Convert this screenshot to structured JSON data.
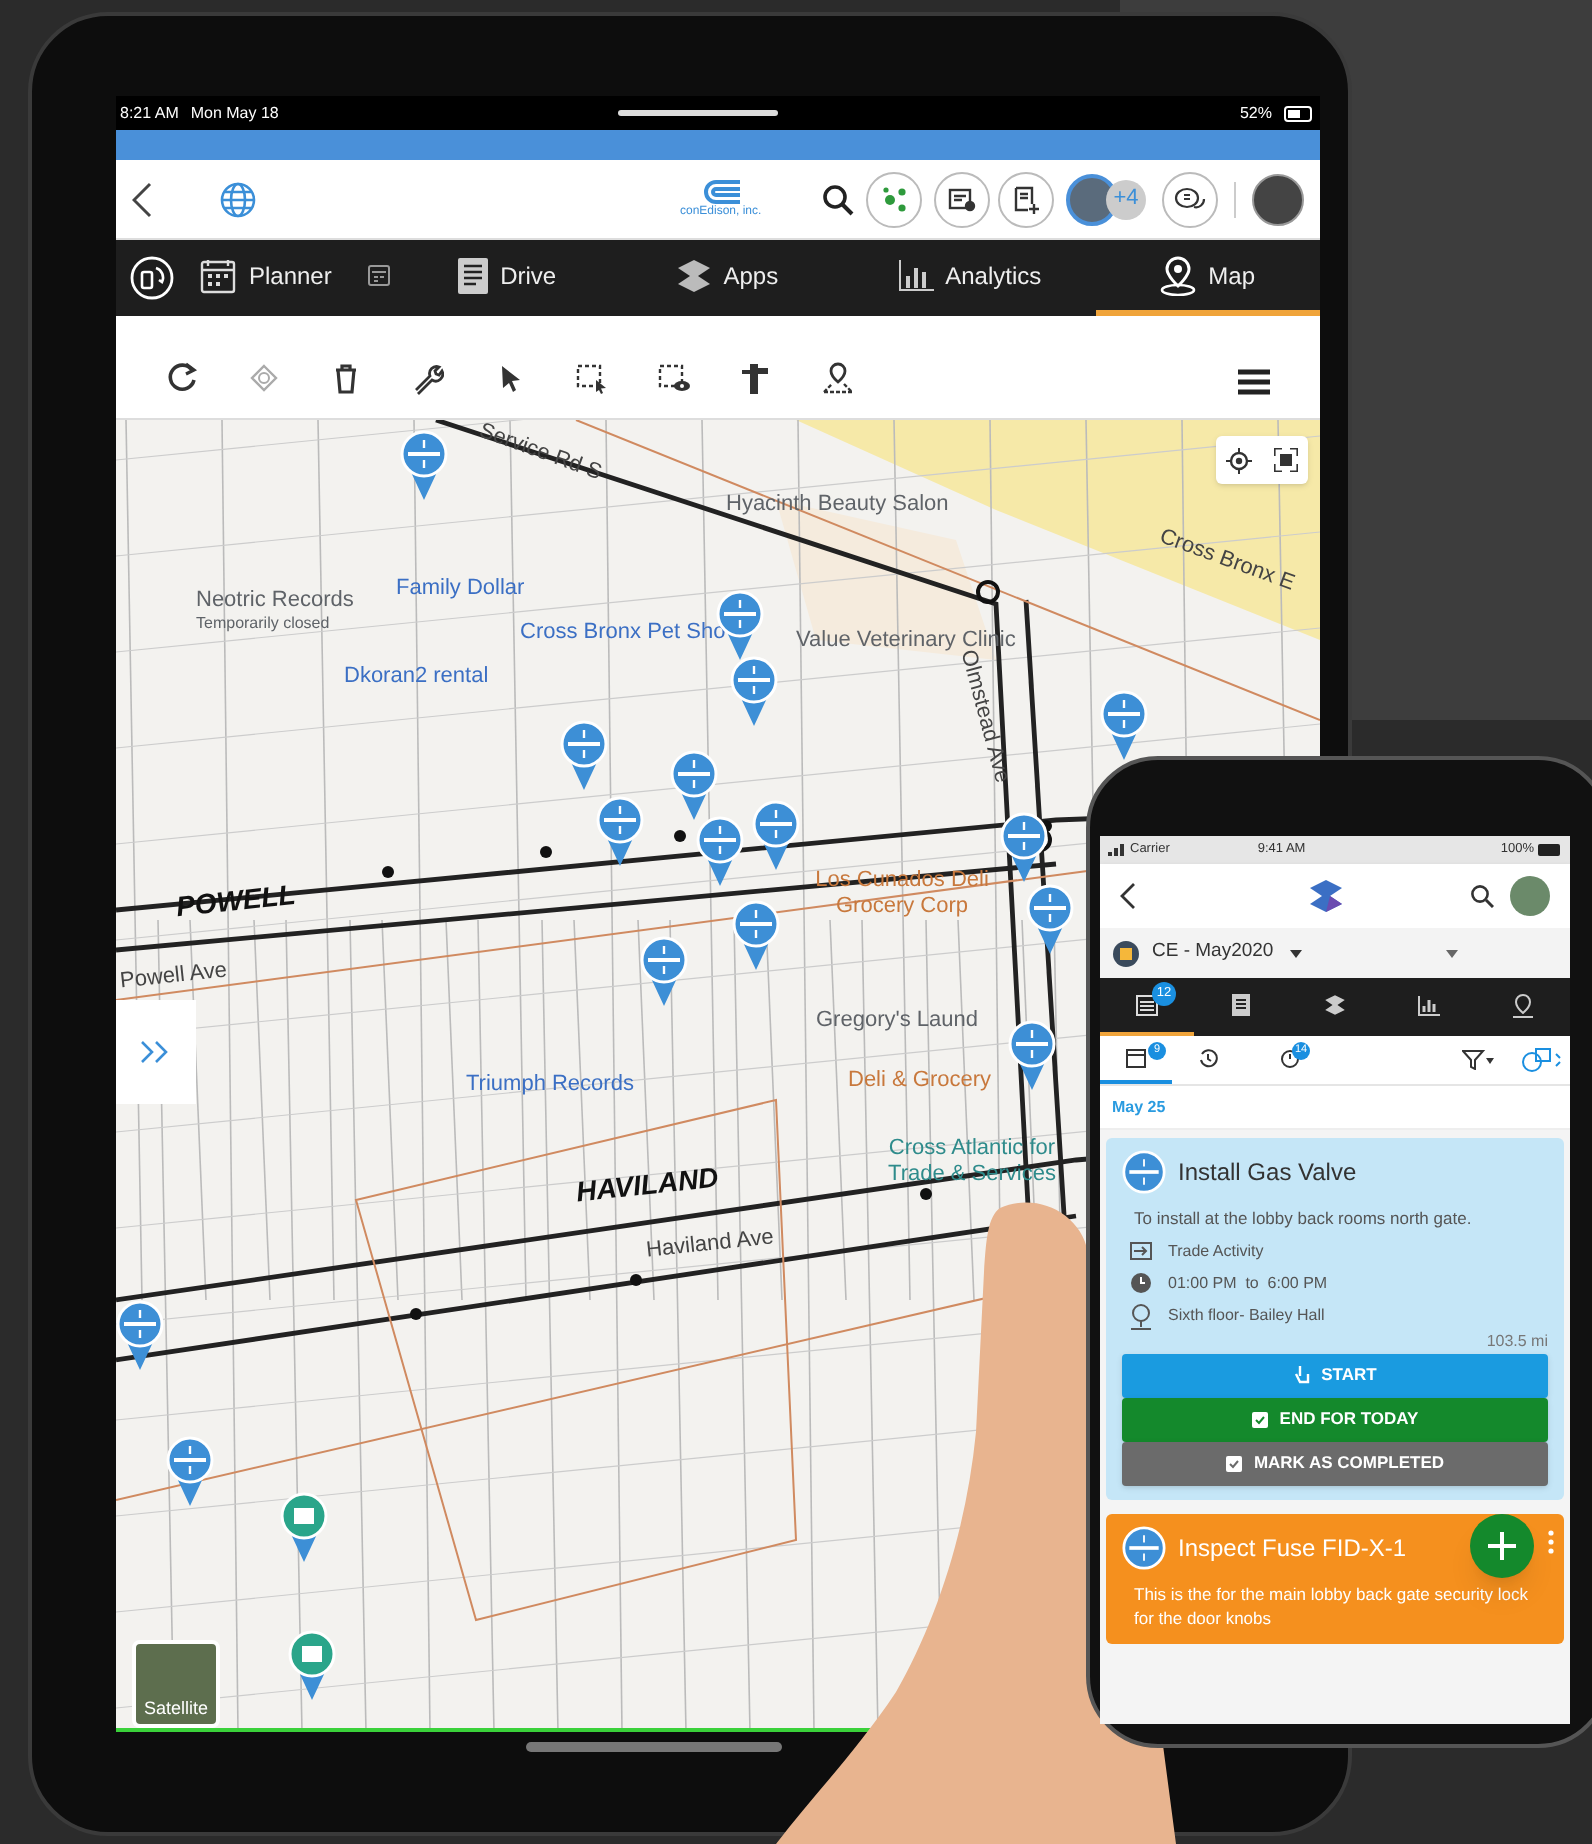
{
  "tablet": {
    "status_bar": {
      "time": "8:21 AM",
      "date": "Mon May 18",
      "battery": "52%"
    },
    "header": {
      "logo_text": "conEdison, inc.",
      "participants_more": "+4"
    },
    "nav_tabs": [
      {
        "label": "Planner",
        "selected": false
      },
      {
        "label": "Drive",
        "selected": false
      },
      {
        "label": "Apps",
        "selected": false
      },
      {
        "label": "Analytics",
        "selected": false
      },
      {
        "label": "Map",
        "selected": true
      }
    ],
    "map": {
      "labels": [
        {
          "kind": "poi",
          "text": "Hyacinth Beauty Salon",
          "color": "#5f6368"
        },
        {
          "kind": "poi",
          "text": "Neotric Records",
          "color": "#5f6368"
        },
        {
          "kind": "note",
          "text": "Temporarily closed",
          "color": "#5f6368"
        },
        {
          "kind": "poi",
          "text": "Family Dollar",
          "color": "#3b6fc4"
        },
        {
          "kind": "poi",
          "text": "Cross Bronx Pet Sho",
          "color": "#3b6fc4"
        },
        {
          "kind": "poi",
          "text": "Value Veterinary Clinic",
          "color": "#5f6368"
        },
        {
          "kind": "poi",
          "text": "Dkoran2 rental",
          "color": "#3b6fc4"
        },
        {
          "kind": "poi",
          "text": "Triumph Records",
          "color": "#3b6fc4"
        },
        {
          "kind": "poi",
          "text": "Los Cunados Deli Grocery Corp",
          "color": "#c8783c"
        },
        {
          "kind": "poi",
          "text": "Gregory's Laund",
          "color": "#5f6368"
        },
        {
          "kind": "poi",
          "text": "Deli & Grocery",
          "color": "#c8783c"
        },
        {
          "kind": "poi",
          "text": "Cross Atlantic for Trade & Services",
          "color": "#2e8b8b"
        },
        {
          "kind": "street",
          "text": "POWELL",
          "color": "#111111"
        },
        {
          "kind": "street",
          "text": "Powell Ave",
          "color": "#444444"
        },
        {
          "kind": "street",
          "text": "HAVILAND",
          "color": "#111111"
        },
        {
          "kind": "street",
          "text": "Haviland Ave",
          "color": "#444444"
        },
        {
          "kind": "street",
          "text": "Olmstead Ave",
          "color": "#444444"
        },
        {
          "kind": "street",
          "text": "Cross Bronx E",
          "color": "#444444"
        },
        {
          "kind": "street",
          "text": "Service Rd S",
          "color": "#444444"
        }
      ],
      "layer_button": "Satellite"
    }
  },
  "phone": {
    "status_bar": {
      "carrier": "Carrier",
      "time": "9:41 AM",
      "battery": "100%"
    },
    "project": "CE - May2020",
    "tabs": [
      {
        "badge": "12",
        "selected": true
      },
      {
        "selected": false
      },
      {
        "selected": false
      },
      {
        "selected": false
      },
      {
        "selected": false
      }
    ],
    "subtabs": [
      {
        "badge": "9",
        "selected": true
      },
      {
        "selected": false
      },
      {
        "badge": "14",
        "selected": false
      }
    ],
    "date": "May 25",
    "tasks": [
      {
        "title": "Install Gas Valve",
        "description": "To install at the lobby back rooms north gate.",
        "activity": "Trade Activity",
        "time": "01:00 PM  to  6:00 PM",
        "location": "Sixth floor- Bailey Hall",
        "distance": "103.5 mi",
        "color": "#c5e6f7",
        "actions": [
          {
            "label": "START",
            "color": "#1a9be0"
          },
          {
            "label": "END FOR TODAY",
            "color": "#14892c"
          },
          {
            "label": "MARK AS COMPLETED",
            "color": "#6b6b6b"
          }
        ]
      },
      {
        "title": "Inspect Fuse FID-X-1",
        "description": "This is the for the main lobby back gate security lock for the door knobs",
        "color": "#f5901e"
      }
    ]
  }
}
